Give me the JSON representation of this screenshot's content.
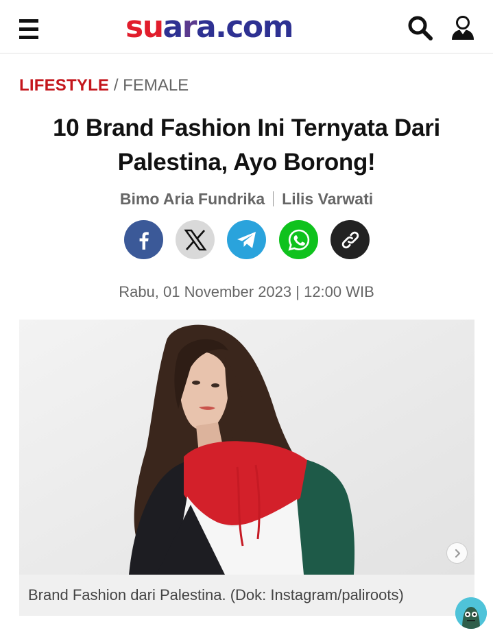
{
  "header": {
    "logo_parts": [
      "s",
      "u",
      "a",
      "r",
      "a.com"
    ],
    "menu_icon": "hamburger-icon",
    "search_icon": "search-icon",
    "user_icon": "user-icon"
  },
  "breadcrumb": {
    "category": "LIFESTYLE",
    "separator": "/",
    "subcategory": "FEMALE"
  },
  "article": {
    "title": "10 Brand Fashion Ini Ternyata Dari Palestina, Ayo Borong!",
    "authors": [
      "Bimo Aria Fundrika",
      "Lilis Varwati"
    ],
    "date": "Rabu, 01 November 2023 | 12:00 WIB"
  },
  "share": [
    {
      "name": "facebook",
      "icon": "facebook-icon",
      "color": "#3b5998"
    },
    {
      "name": "x",
      "icon": "x-icon",
      "color": "#d9d9d9"
    },
    {
      "name": "telegram",
      "icon": "telegram-icon",
      "color": "#2aa3dc"
    },
    {
      "name": "whatsapp",
      "icon": "whatsapp-icon",
      "color": "#0fc21d"
    },
    {
      "name": "copy-link",
      "icon": "link-icon",
      "color": "#222222"
    }
  ],
  "figure": {
    "caption": "Brand Fashion dari Palestina. (Dok: Instagram/paliroots)",
    "next_icon": "chevron-right-icon"
  },
  "colors": {
    "brand_red": "#e11d2c",
    "brand_blue": "#2e3192",
    "category_red": "#c4161c"
  }
}
